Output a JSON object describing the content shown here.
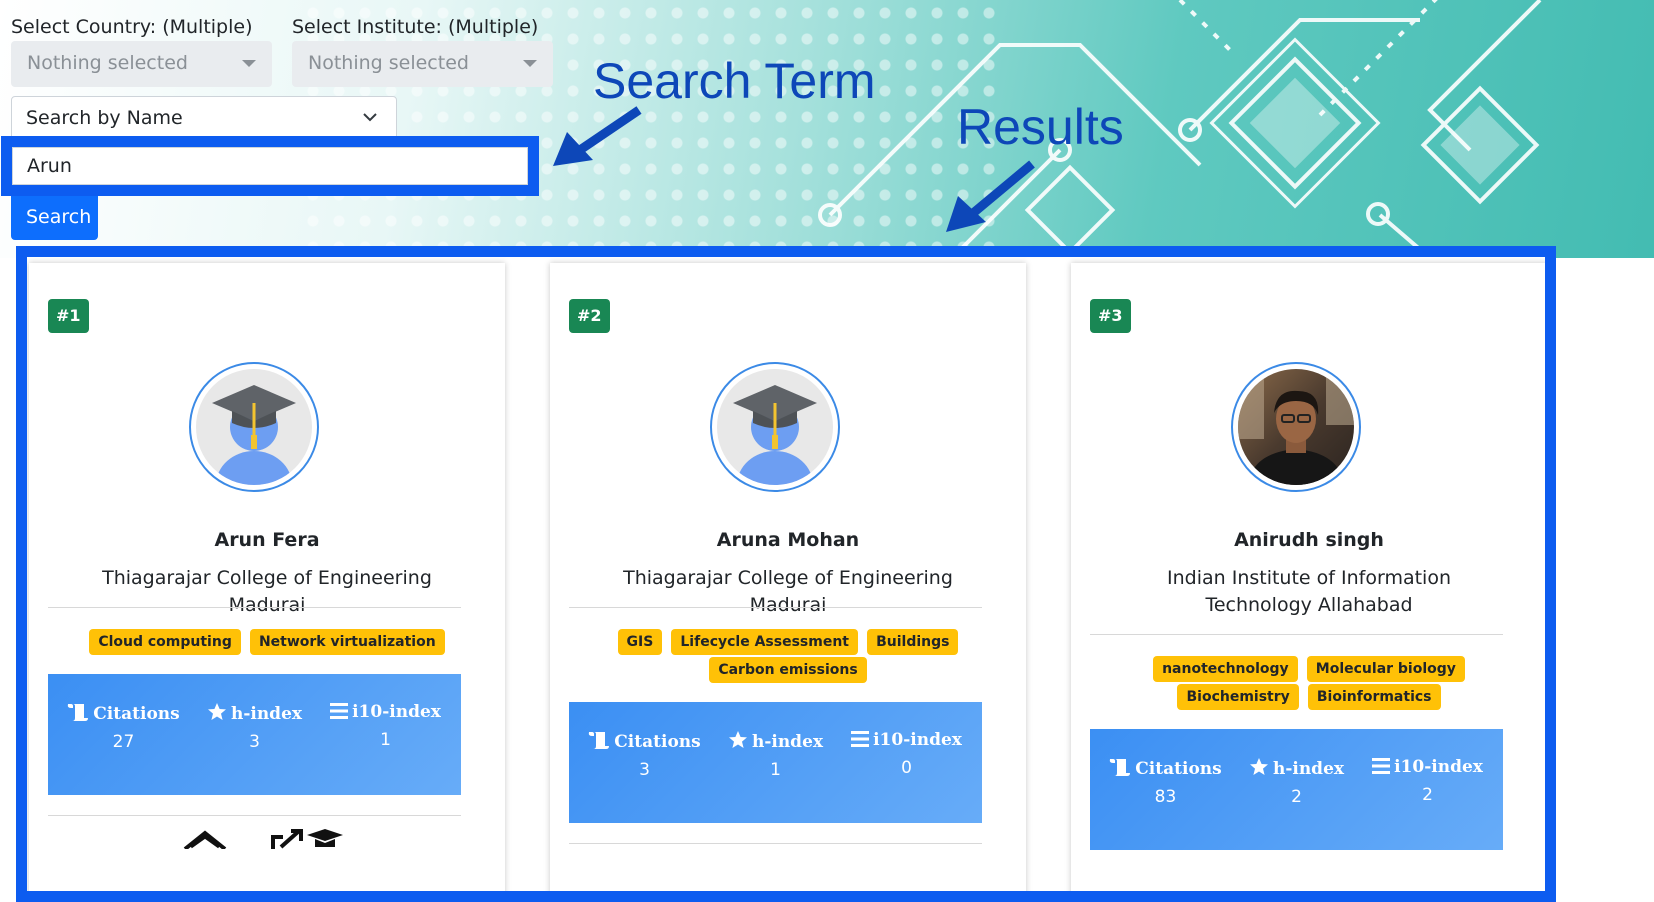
{
  "filters": {
    "country_label": "Select Country: (Multiple)",
    "country_value": "Nothing selected",
    "institute_label": "Select Institute: (Multiple)",
    "institute_value": "Nothing selected"
  },
  "search": {
    "type_value": "Search by Name",
    "input_value": "Arun",
    "button_label": "Search"
  },
  "annotations": {
    "search_term": "Search Term",
    "results": "Results"
  },
  "colors": {
    "highlight": "#0d5cf0",
    "rank_badge": "#198754",
    "tag": "#ffc107",
    "stats_panel": "#4d9df6",
    "button": "#0d6efd"
  },
  "stat_labels": {
    "citations": "Citations",
    "h_index": "h-index",
    "i10_index": "i10-index"
  },
  "results": [
    {
      "rank": "#1",
      "avatar": "graduation-cap-default-avatar",
      "name": "Arun Fera",
      "institute": "Thiagarajar College of Engineering Madurai",
      "tags": [
        "Cloud computing",
        "Network virtualization"
      ],
      "citations": "27",
      "h_index": "3",
      "i10_index": "1"
    },
    {
      "rank": "#2",
      "avatar": "graduation-cap-default-avatar",
      "name": "Aruna Mohan",
      "institute": "Thiagarajar College of Engineering Madurai",
      "tags": [
        "GIS",
        "Lifecycle Assessment",
        "Buildings",
        "Carbon emissions"
      ],
      "citations": "3",
      "h_index": "1",
      "i10_index": "0"
    },
    {
      "rank": "#3",
      "avatar": "profile-photo",
      "name": "Anirudh singh",
      "institute": "Indian Institute of Information Technology Allahabad",
      "tags": [
        "nanotechnology",
        "Molecular biology",
        "Biochemistry",
        "Bioinformatics"
      ],
      "citations": "83",
      "h_index": "2",
      "i10_index": "2"
    }
  ]
}
